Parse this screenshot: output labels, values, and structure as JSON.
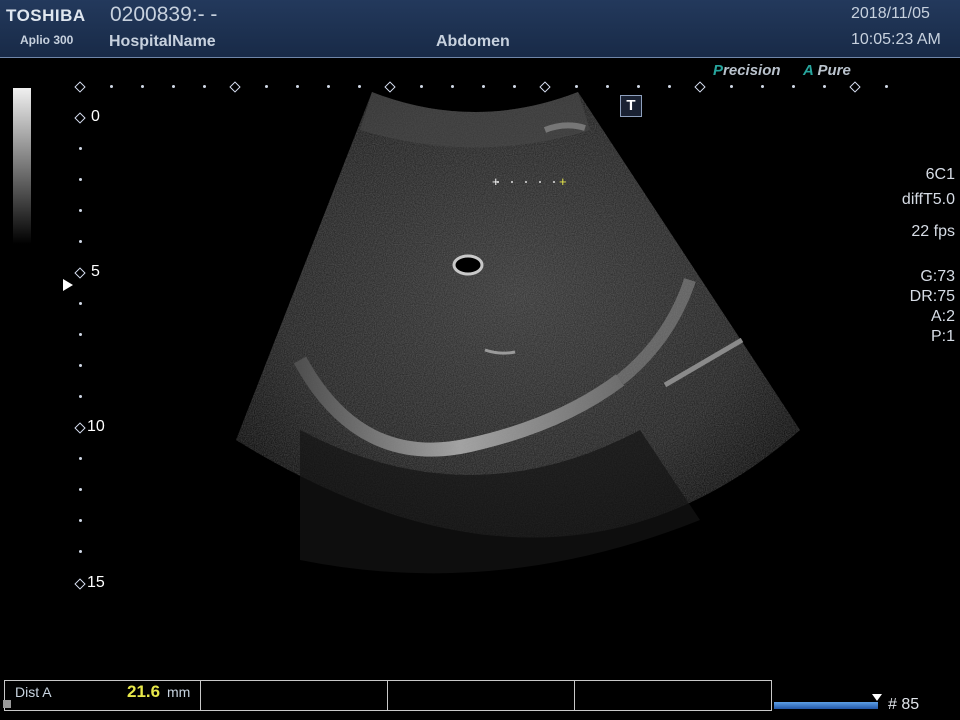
{
  "header": {
    "logo": "TOSHIBA",
    "model": "Aplio 300",
    "patient_id": "0200839:- -",
    "hospital": "HospitalName",
    "exam": "Abdomen",
    "date": "2018/11/05",
    "time": "10:05:23 AM"
  },
  "brand": {
    "precision_initial": "P",
    "precision_rest": "recision",
    "apure_initial": "A",
    "apure_rest": "Pure",
    "accent_color": "#27a59d"
  },
  "tools": {
    "t_marker": "T"
  },
  "depth_scale": {
    "labels": [
      "0",
      "5",
      "10",
      "15"
    ]
  },
  "params": {
    "probe": "6C1",
    "preset": "diffT5.0",
    "frame_rate": "22 fps",
    "gain": "G:73",
    "dynamic_range": "DR:75",
    "a": "A:2",
    "p": "P:1"
  },
  "measurement": {
    "label": "Dist A",
    "value": "21.6",
    "unit": "mm",
    "value_color": "#e8e84a"
  },
  "cine": {
    "frame": "# 85"
  },
  "caliper": {
    "start": "+",
    "end": "+"
  }
}
